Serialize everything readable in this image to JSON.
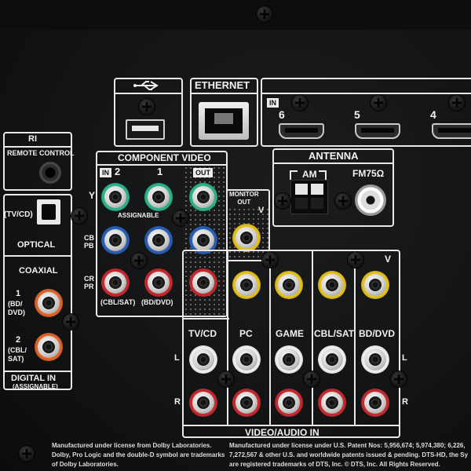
{
  "labels": {
    "ri": "RI",
    "remote_control": "REMOTE CONTROL",
    "tv_cd": "(TV/CD)",
    "optical": "OPTICAL",
    "coaxial": "COAXIAL",
    "coax1_num": "1",
    "coax1_desc": "(BD/\nDVD)",
    "coax2_num": "2",
    "coax2_desc": "(CBL/\nSAT)",
    "digital_in": "DIGITAL IN",
    "assignable_paren": "(ASSIGNABLE)",
    "ethernet": "ETHERNET",
    "in_tag": "IN",
    "hdmi_6": "6",
    "hdmi_5": "5",
    "hdmi_4": "4",
    "antenna": "ANTENNA",
    "am": "AM",
    "fm": "FM75Ω",
    "component_video": "COMPONENT VIDEO",
    "comp_in_tag": "IN",
    "comp_2": "2",
    "comp_1": "1",
    "comp_out_tag": "OUT",
    "assignable": "ASSIGNABLE",
    "y": "Y",
    "cb_pb": "CB\nPB",
    "cr_pr": "CR\nPR",
    "cbl_sat": "(CBL/SAT)",
    "bd_dvd": "(BD/DVD)",
    "monitor_out": "MONITOR\nOUT",
    "v_monitor": "V",
    "v_right": "V",
    "tv_cd_col": "TV/CD",
    "pc": "PC",
    "game": "GAME",
    "cbl_sat_col": "CBL/SAT",
    "bd_dvd_col": "BD/DVD",
    "l_left": "L",
    "r_left": "R",
    "l_right": "L",
    "r_right": "R",
    "video_audio_in": "VIDEO/AUDIO IN",
    "legal_dolby": "Manufactured under license from Dolby Laboratories.\nDolby, Pro Logic and the double-D symbol are trademarks\nof Dolby Laboratories.",
    "legal_dts": "Manufactured under license under U.S. Patent Nos: 5,956,674; 5,974,380; 6,226,\n7,272,567 & other U.S. and worldwide patents issued & pending. DTS-HD, the Sy\nare registered trademarks of DTS, Inc. © DTS, Inc. All Rights Reserved."
  },
  "icons": {
    "usb": "usb-icon"
  },
  "colors": {
    "panel": "#121314",
    "green": "#2bb38a",
    "blue": "#2a5fb5",
    "red": "#c62a2f",
    "yellow": "#e5c21a",
    "white": "#f0f0f0",
    "orange": "#e0662a"
  }
}
